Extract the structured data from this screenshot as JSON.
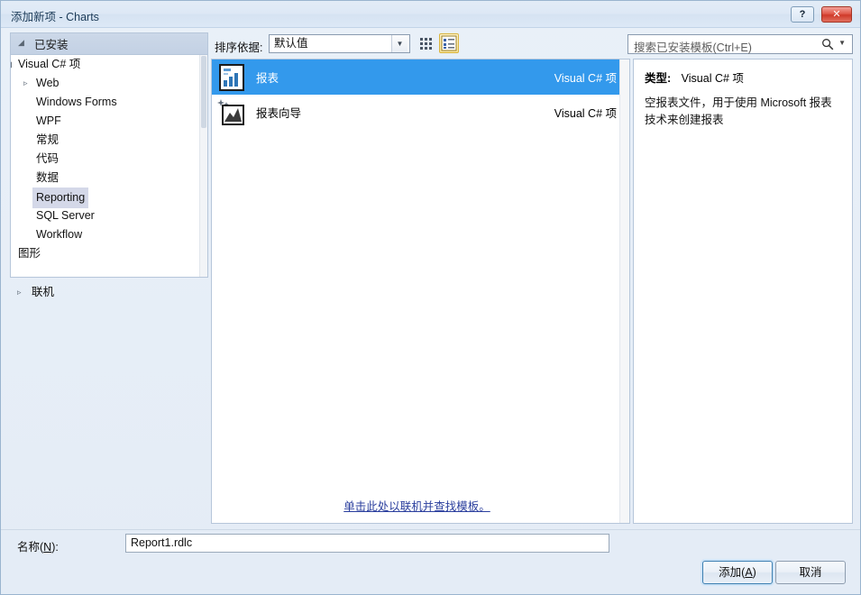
{
  "window": {
    "title": "添加新项 - Charts",
    "help_button": "?",
    "close_button": "✕"
  },
  "left_panel": {
    "installed_header": "已安装",
    "tree": [
      {
        "label": "Visual C# 项",
        "level": 0,
        "expander": "open",
        "selected": false
      },
      {
        "label": "Web",
        "level": 1,
        "expander": "closed",
        "selected": false
      },
      {
        "label": "Windows Forms",
        "level": 1,
        "expander": "none",
        "selected": false
      },
      {
        "label": "WPF",
        "level": 1,
        "expander": "none",
        "selected": false
      },
      {
        "label": "常规",
        "level": 1,
        "expander": "none",
        "selected": false
      },
      {
        "label": "代码",
        "level": 1,
        "expander": "none",
        "selected": false
      },
      {
        "label": "数据",
        "level": 1,
        "expander": "none",
        "selected": false
      },
      {
        "label": "Reporting",
        "level": 1,
        "expander": "none",
        "selected": true
      },
      {
        "label": "SQL Server",
        "level": 1,
        "expander": "none",
        "selected": false
      },
      {
        "label": "Workflow",
        "level": 1,
        "expander": "none",
        "selected": false
      },
      {
        "label": "图形",
        "level": 0,
        "expander": "none",
        "selected": false
      }
    ],
    "online_node": {
      "label": "联机",
      "expander": "closed"
    }
  },
  "toolbar": {
    "sort_label": "排序依据:",
    "sort_value": "默认值",
    "view_grid_icon": "grid-view-icon",
    "view_list_icon": "list-view-icon"
  },
  "search": {
    "placeholder": "搜索已安装模板(Ctrl+E)",
    "icon": "search-icon",
    "dropdown_icon": "chevron-down-icon"
  },
  "list": {
    "items": [
      {
        "name": "报表",
        "kind": "Visual C# 项",
        "icon": "report-chart-icon",
        "selected": true
      },
      {
        "name": "报表向导",
        "kind": "Visual C# 项",
        "icon": "report-wizard-icon",
        "selected": false
      }
    ],
    "online_link": "单击此处以联机并查找模板。"
  },
  "details": {
    "type_label": "类型:",
    "type_value": "Visual C# 项",
    "description": "空报表文件，用于使用 Microsoft 报表技术来创建报表"
  },
  "footer": {
    "name_label_prefix": "名称(",
    "name_label_accel": "N",
    "name_label_suffix": "):",
    "name_value": "Report1.rdlc",
    "add_prefix": "添加(",
    "add_accel": "A",
    "add_suffix": ")",
    "cancel_label": "取消"
  },
  "colors": {
    "selection_blue": "#3399ec",
    "tree_selection": "#d4d8e8",
    "link_blue": "#2b3f9e",
    "close_red": "#cf3a2a"
  }
}
